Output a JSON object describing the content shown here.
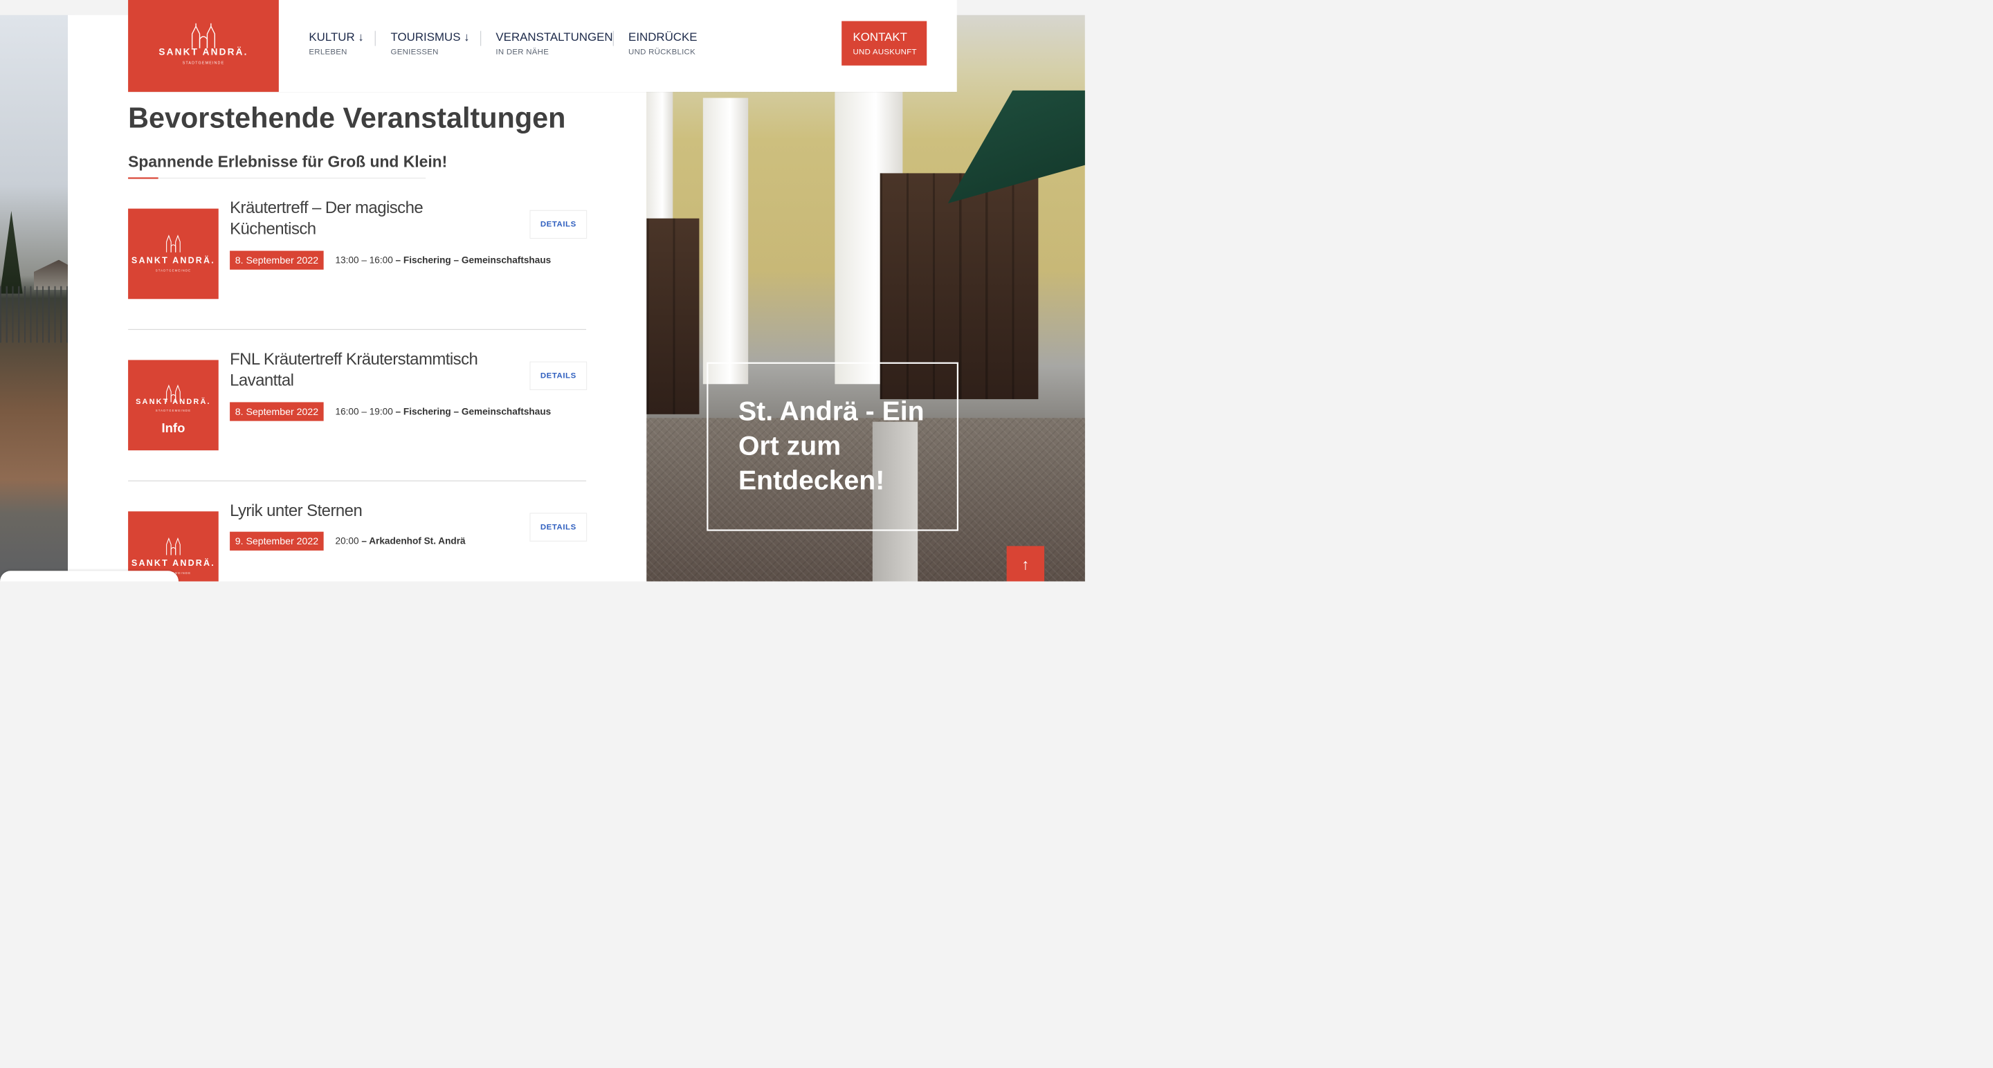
{
  "brand": {
    "name": "SANKT ANDRÄ.",
    "sub": "STADTGEMEINDE",
    "color": "#d94434"
  },
  "nav": [
    {
      "label": "KULTUR ↓",
      "sub": "ERLEBEN"
    },
    {
      "label": "TOURISMUS ↓",
      "sub": "GENIESSEN"
    },
    {
      "label": "VERANSTALTUNGEN",
      "sub": "IN DER NÄHE"
    },
    {
      "label": "EINDRÜCKE",
      "sub": "UND RÜCKBLICK"
    }
  ],
  "contact": {
    "label": "KONTAKT",
    "sub": "UND AUSKUNFT"
  },
  "page": {
    "title": "Bevorstehende Veranstaltungen",
    "subtitle": "Spannende Erlebnisse für Groß und Klein!"
  },
  "events": [
    {
      "title": "Kräutertreff – Der magische Küchentisch",
      "date": "8. September 2022",
      "time": "13:00 – 16:00",
      "location": "– Fischering – Gemeinschaftshaus",
      "details": "DETAILS",
      "thumb_label": "SANKT ANDRÄ.",
      "thumb_sub": "STADTGEMEINDE"
    },
    {
      "title": "FNL Kräutertreff Kräuterstammtisch Lavanttal",
      "date": "8. September 2022",
      "time": "16:00 – 19:00",
      "location": "– Fischering – Gemeinschaftshaus",
      "details": "DETAILS",
      "thumb_label": "SANKT ANDRÄ.",
      "thumb_sub": "STADTGEMEINDE",
      "thumb_info": "Info"
    },
    {
      "title": "Lyrik unter Sternen",
      "date": "9. September 2022",
      "time": "20:00",
      "location": "– Arkadenhof St. Andrä",
      "details": "DETAILS",
      "thumb_label": "SANKT ANDRÄ.",
      "thumb_sub": "STADTGEMEINDE"
    }
  ],
  "hero": {
    "text": "St. Andrä - Ein Ort zum Entdecken!"
  },
  "scroll_top": "↑",
  "icons": {
    "logo": "church-logo-icon",
    "scroll": "arrow-up-icon"
  }
}
